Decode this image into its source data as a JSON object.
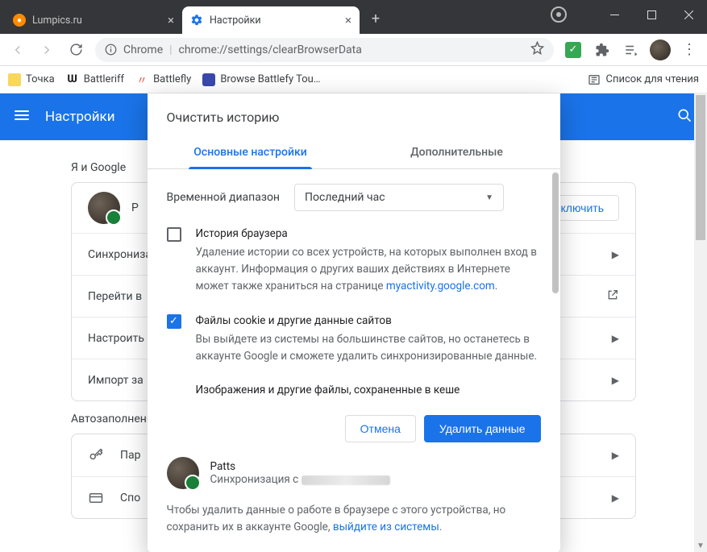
{
  "titlebar": {
    "tabs": [
      {
        "label": "Lumpics.ru",
        "favicon_color": "#ff8a00"
      },
      {
        "label": "Настройки",
        "favicon": "gear"
      }
    ]
  },
  "toolbar": {
    "origin_label": "Chrome",
    "url": "chrome://settings/clearBrowserData"
  },
  "bookmarks": {
    "items": [
      {
        "label": "Точка",
        "color": "#f4c20d"
      },
      {
        "label": "Battleriff",
        "color": "#111"
      },
      {
        "label": "Battlefly",
        "color": "#e8483a"
      },
      {
        "label": "Browse Battlefy Tou…",
        "color": "#3949ab"
      }
    ],
    "reading_list_label": "Список для чтения"
  },
  "settings": {
    "title": "Настройки",
    "section1_title": "Я и Google",
    "profile_initial": "P",
    "sync_btn": "Включить",
    "rows": {
      "sync": "Синхрониза",
      "go": "Перейти в",
      "customize": "Настроить",
      "import": "Импорт за"
    },
    "section2_title": "Автозаполнение",
    "row_passwords": "Пар",
    "row_payments": "Спо"
  },
  "dialog": {
    "title": "Очистить историю",
    "tab_basic": "Основные настройки",
    "tab_advanced": "Дополнительные",
    "time_label": "Временной диапазон",
    "time_value": "Последний час",
    "item1": {
      "title": "История браузера",
      "desc_a": "Удаление истории со всех устройств, на которых выполнен вход в аккаунт. Информация о других ваших действиях в Интернете может также храниться на странице ",
      "link": "myactivity.google.com",
      "desc_b": "."
    },
    "item2": {
      "title": "Файлы cookie и другие данные сайтов",
      "desc": "Вы выйдете из системы на большинстве сайтов, но останетесь в аккаунте Google и сможете удалить синхронизированные данные."
    },
    "item3": {
      "title": "Изображения и другие файлы, сохраненные в кеше"
    },
    "cancel": "Отмена",
    "confirm": "Удалить данные",
    "account_name": "Patts",
    "account_sync_prefix": "Синхронизация с ",
    "note_a": "Чтобы удалить данные о работе в браузере с этого устройства, но сохранить их в аккаунте Google, ",
    "note_link": "выйдите из системы",
    "note_b": "."
  }
}
